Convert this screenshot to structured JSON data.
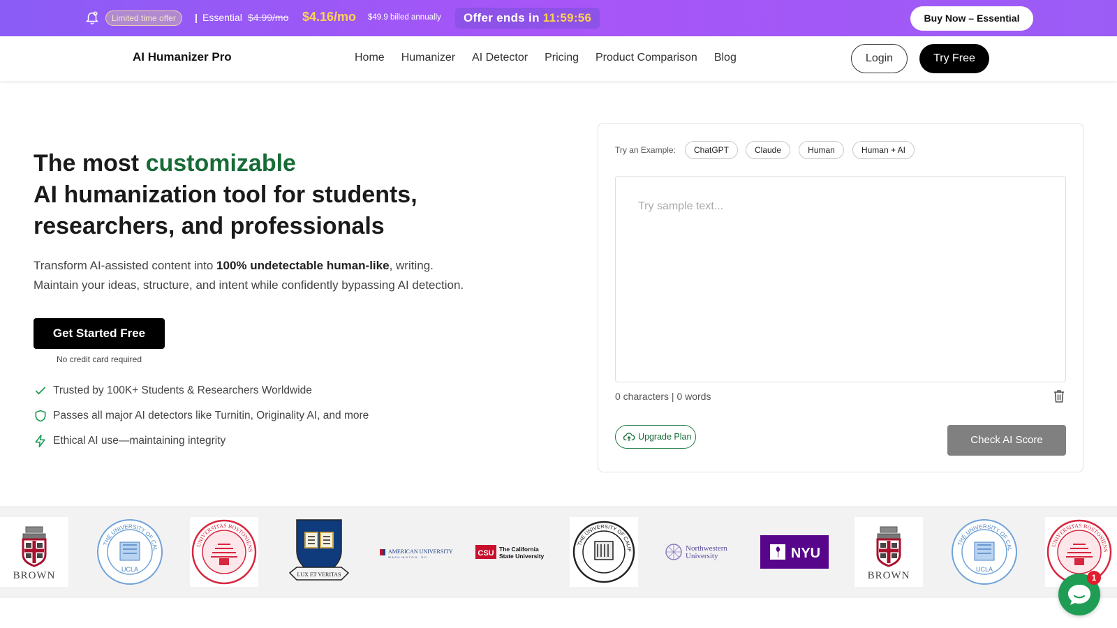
{
  "promo": {
    "badge": "Limited time offer",
    "separator": "|",
    "plan": "Essential",
    "old_price": "$4.99/mo",
    "new_price": "$4.16/mo",
    "billed": "$49.9 billed annually",
    "offer_label": "Offer ends in",
    "timer": "11:59:56",
    "buy_button": "Buy Now – Essential",
    "colors": {
      "background": "#9b5cf6",
      "price": "#fcd34d"
    }
  },
  "nav": {
    "logo": "AI Humanizer Pro",
    "links": [
      "Home",
      "Humanizer",
      "AI Detector",
      "Pricing",
      "Product Comparison",
      "Blog"
    ],
    "login": "Login",
    "try_free": "Try Free"
  },
  "hero": {
    "title_prefix": "The most ",
    "title_accent": "customizable",
    "title_line2": "AI humanization tool for students,",
    "title_line3": "researchers, and professionals",
    "sub_prefix": "Transform AI-assisted content into ",
    "sub_bold": "100% undetectable human-like",
    "sub_suffix": ", writing.",
    "sub_line2": "Maintain your ideas, structure, and intent while confidently bypassing AI detection.",
    "cta": "Get Started Free",
    "cta_note": "No credit card required",
    "features": [
      {
        "icon": "check-icon",
        "text": "Trusted by 100K+ Students & Researchers Worldwide"
      },
      {
        "icon": "shield-icon",
        "text": "Passes all major AI detectors like Turnitin, Originality AI, and more"
      },
      {
        "icon": "lightning-icon",
        "text": "Ethical AI use—maintaining integrity"
      }
    ],
    "accent_color": "#176b37"
  },
  "editor": {
    "try_label": "Try an Example:",
    "examples": [
      "ChatGPT",
      "Claude",
      "Human",
      "Human + AI"
    ],
    "placeholder": "Try sample text...",
    "count": "0 characters | 0 words",
    "upgrade": "Upgrade Plan",
    "check": "Check AI Score"
  },
  "logos": {
    "brown": "BROWN",
    "ucla_ring": "THE UNIVERSITY OF CALIFORNIA",
    "ucla": "UCLA",
    "bu_ring": "UNIVERSITAS BOSTONIENSIS",
    "yale_motto": "LUX ET VERITAS",
    "american": "AMERICAN UNIVERSITY",
    "american_sub": "WASHINGTON, DC",
    "csu_mark": "CSU",
    "csu_line1": "The California",
    "csu_line2": "State University",
    "northwestern_line1": "Northwestern",
    "northwestern_line2": "University",
    "nyu": "NYU"
  },
  "chat": {
    "notification_count": "1"
  }
}
